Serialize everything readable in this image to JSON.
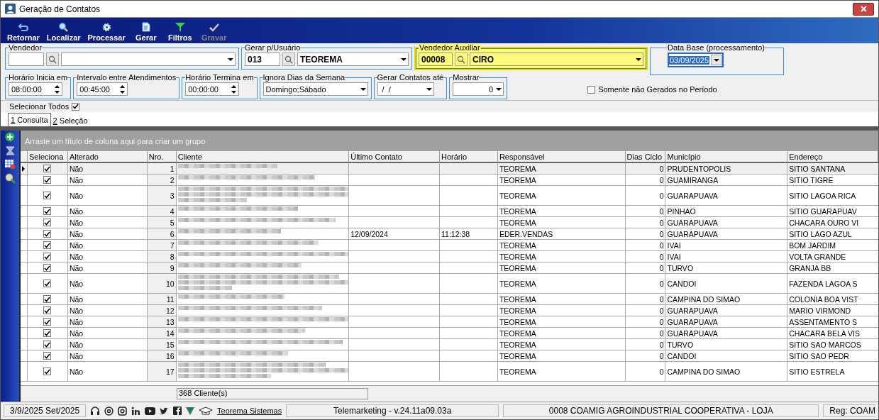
{
  "window": {
    "title": "Geração de Contatos"
  },
  "toolbar": [
    {
      "label": "Retornar",
      "kind": "back",
      "disabled": false
    },
    {
      "label": "Localizar",
      "kind": "search",
      "disabled": false
    },
    {
      "label": "Processar",
      "kind": "gear",
      "disabled": false
    },
    {
      "label": "Gerar",
      "kind": "doc",
      "disabled": false
    },
    {
      "label": "Filtros",
      "kind": "filter",
      "disabled": false
    },
    {
      "label": "Gravar",
      "kind": "check",
      "disabled": true
    }
  ],
  "vendedor": {
    "label": "Vendedor"
  },
  "gerar_usuario": {
    "label": "Gerar p/Usuário",
    "code": "013",
    "name": "TEOREMA"
  },
  "vendedor_auxiliar": {
    "label": "Vendedor Auxiliar",
    "code": "00008",
    "name": "CIRO",
    "highlighted": true
  },
  "data_base": {
    "label": "Data Base (processamento)",
    "value": "03/09/2025"
  },
  "horario_inicia": {
    "label": "Horário Inicia em",
    "value": "08:00:00"
  },
  "intervalo": {
    "label": "Intervalo entre Atendimentos",
    "value": "00:45:00"
  },
  "horario_termina": {
    "label": "Horário Termina em",
    "value": "00:00:00"
  },
  "ignora_dias": {
    "label": "Ignora Dias da Semana",
    "value": "Domingo;Sábado"
  },
  "gerar_ate": {
    "label": "Gerar Contatos até",
    "value": " /  /"
  },
  "mostrar": {
    "label": "Mostrar",
    "value": "0"
  },
  "somente": {
    "label": "Somente não Gerados no Período",
    "checked": false
  },
  "selecionar_todos": {
    "label": "Selecionar Todos",
    "checked": true
  },
  "tabs": [
    {
      "number": "1",
      "label": "Consulta",
      "selected": true
    },
    {
      "number": "2",
      "label": "Seleção",
      "selected": false
    }
  ],
  "group_panel": "Arraste um título de coluna aqui para criar um grupo",
  "table": {
    "columns": [
      "Seleciona",
      "Alterado",
      "Nro.",
      "Cliente",
      "Último Contato",
      "Horário",
      "Responsável",
      "Dias Ciclo",
      "Município",
      "Endereço"
    ],
    "rows": [
      {
        "selected": true,
        "checked": true,
        "tall": false,
        "alterado": "Não",
        "nro": "1",
        "responsavel": "TEOREMA",
        "dias": "0",
        "municipio": "PRUDENTOPOLIS",
        "endereco": "SITIO SANTANA"
      },
      {
        "selected": false,
        "checked": true,
        "tall": false,
        "alterado": "Não",
        "nro": "2",
        "responsavel": "TEOREMA",
        "dias": "0",
        "municipio": "GUAMIRANGA",
        "endereco": "SITIO TIGRE"
      },
      {
        "selected": false,
        "checked": true,
        "tall": true,
        "alterado": "Não",
        "nro": "3",
        "responsavel": "TEOREMA",
        "dias": "0",
        "municipio": "GUARAPUAVA",
        "endereco": "SITIO LAGOA RICA"
      },
      {
        "selected": false,
        "checked": true,
        "tall": false,
        "alterado": "Não",
        "nro": "4",
        "responsavel": "TEOREMA",
        "dias": "0",
        "municipio": "PINHAO",
        "endereco": "SITIO GUARAPUAV"
      },
      {
        "selected": false,
        "checked": true,
        "tall": false,
        "alterado": "Não",
        "nro": "5",
        "responsavel": "TEOREMA",
        "dias": "0",
        "municipio": "GUARAPUAVA",
        "endereco": "CHACARA OURO VI"
      },
      {
        "selected": false,
        "checked": true,
        "tall": false,
        "alterado": "Não",
        "nro": "6",
        "ultimo": "12/09/2024",
        "horario": "11:12:38",
        "responsavel": "EDER.VENDAS",
        "dias": "0",
        "municipio": "GUARAPUAVA",
        "endereco": "SITIO LAGO AZUL"
      },
      {
        "selected": false,
        "checked": true,
        "tall": false,
        "alterado": "Não",
        "nro": "7",
        "responsavel": "TEOREMA",
        "dias": "0",
        "municipio": "IVAI",
        "endereco": "BOM JARDIM"
      },
      {
        "selected": false,
        "checked": true,
        "tall": false,
        "alterado": "Não",
        "nro": "8",
        "responsavel": "TEOREMA",
        "dias": "0",
        "municipio": "IVAI",
        "endereco": "VOLTA GRANDE"
      },
      {
        "selected": false,
        "checked": true,
        "tall": false,
        "alterado": "Não",
        "nro": "9",
        "responsavel": "TEOREMA",
        "dias": "0",
        "municipio": "TURVO",
        "endereco": "GRANJA BB"
      },
      {
        "selected": false,
        "checked": true,
        "tall": true,
        "alterado": "Não",
        "nro": "10",
        "responsavel": "TEOREMA",
        "dias": "0",
        "municipio": "CANDOI",
        "endereco": "FAZENDA LAGOA S"
      },
      {
        "selected": false,
        "checked": true,
        "tall": false,
        "alterado": "Não",
        "nro": "11",
        "responsavel": "TEOREMA",
        "dias": "0",
        "municipio": "CAMPINA DO SIMAO",
        "endereco": "COLONIA BOA VIST"
      },
      {
        "selected": false,
        "checked": true,
        "tall": false,
        "alterado": "Não",
        "nro": "12",
        "responsavel": "TEOREMA",
        "dias": "0",
        "municipio": "GUARAPUAVA",
        "endereco": "MARIO VIRMOND"
      },
      {
        "selected": false,
        "checked": true,
        "tall": false,
        "alterado": "Não",
        "nro": "13",
        "responsavel": "TEOREMA",
        "dias": "0",
        "municipio": "GUARAPUAVA",
        "endereco": "ASSENTAMENTO S"
      },
      {
        "selected": false,
        "checked": true,
        "tall": false,
        "alterado": "Não",
        "nro": "14",
        "responsavel": "TEOREMA",
        "dias": "0",
        "municipio": "GUARAPUAVA",
        "endereco": "CHACARA BELA VIS"
      },
      {
        "selected": false,
        "checked": true,
        "tall": false,
        "alterado": "Não",
        "nro": "15",
        "responsavel": "TEOREMA",
        "dias": "0",
        "municipio": "TURVO",
        "endereco": "SITIO SAO MARCOS"
      },
      {
        "selected": false,
        "checked": true,
        "tall": false,
        "alterado": "Não",
        "nro": "16",
        "responsavel": "TEOREMA",
        "dias": "0",
        "municipio": "CANDOI",
        "endereco": "SITIO SAO PEDR"
      },
      {
        "selected": false,
        "checked": true,
        "tall": true,
        "alterado": "Não",
        "nro": "17",
        "responsavel": "TEOREMA",
        "dias": "0",
        "municipio": "CAMPINA DO SIMAO",
        "endereco": "SITIO ESTRELA"
      }
    ],
    "footer": "368 Cliente(s)"
  },
  "status_bar": {
    "date": "3/9/2025 Set/2025",
    "link": "Teorema Sistemas",
    "module": "Telemarketing - v.24.11a09.03a",
    "company": "0008 COAMIG AGROINDUSTRIAL COOPERATIVA - LOJA",
    "reg": "Reg: COAM"
  }
}
